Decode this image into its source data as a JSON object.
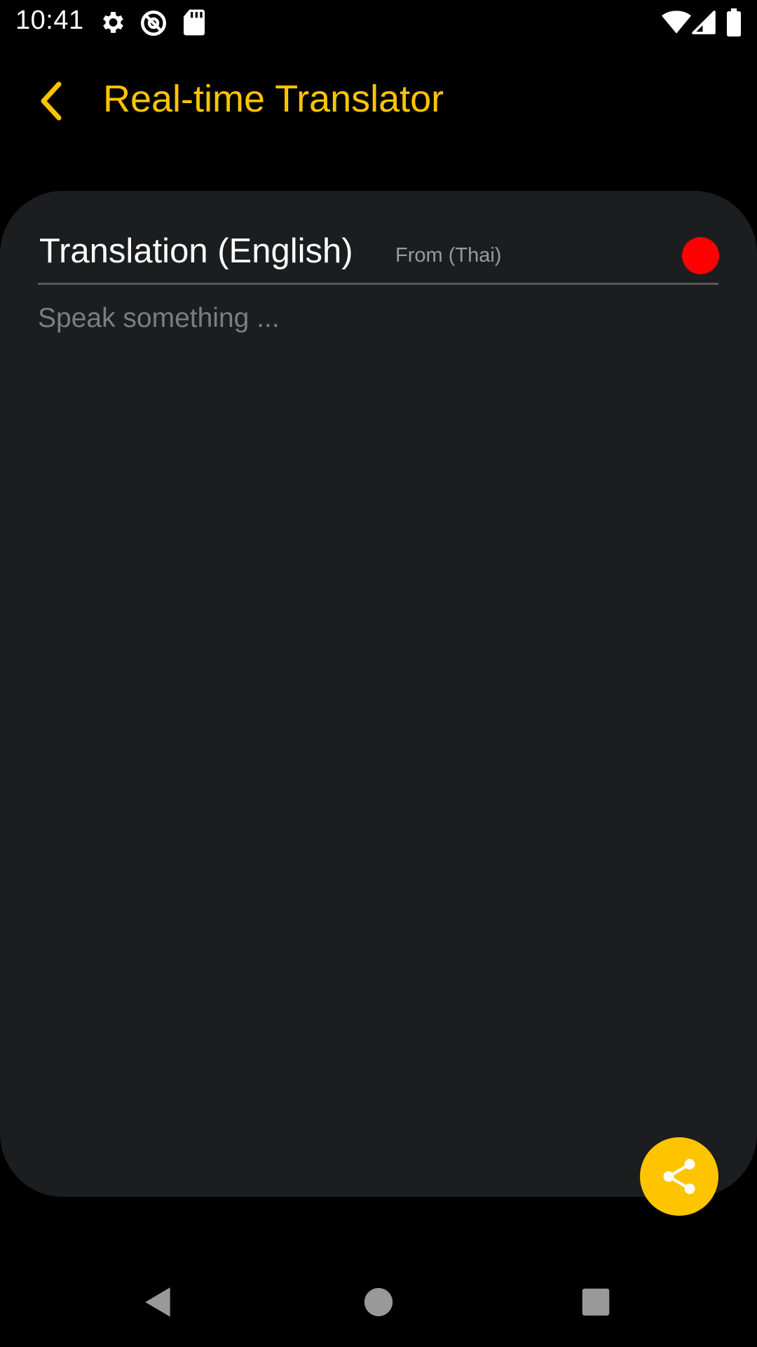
{
  "status_bar": {
    "time": "10:41",
    "icons": [
      "gear-icon",
      "at-sign-icon",
      "sd-card-icon",
      "wifi-icon",
      "signal-icon",
      "battery-icon"
    ]
  },
  "app_bar": {
    "back_icon": "chevron-left-icon",
    "title": "Real-time Translator"
  },
  "card": {
    "title": "Translation (English)",
    "from_label": "From (Thai)",
    "record_color": "#FF0000",
    "input_placeholder": "Speak something ..."
  },
  "fab": {
    "icon": "share-icon"
  },
  "nav_bar": {
    "buttons": [
      "back-triangle-icon",
      "home-circle-icon",
      "recents-square-icon"
    ]
  },
  "colors": {
    "accent": "#FFC400",
    "background": "#000000",
    "card": "#1C1D1F",
    "record": "#FF0000"
  }
}
